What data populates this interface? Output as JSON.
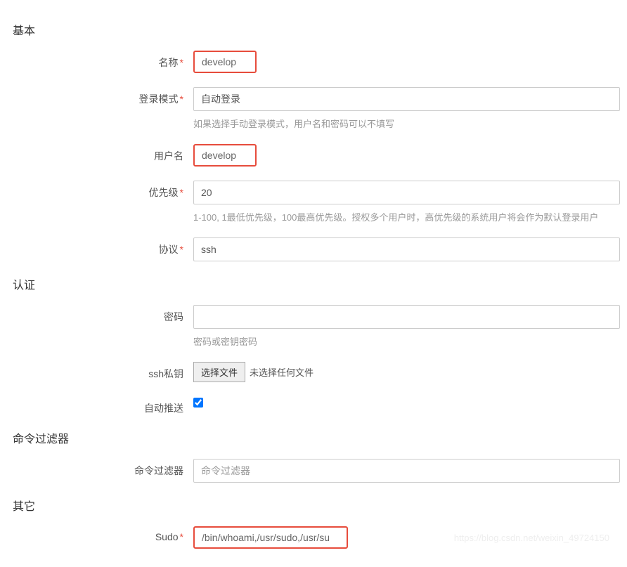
{
  "sections": {
    "basic": "基本",
    "auth": "认证",
    "filter": "命令过滤器",
    "other": "其它"
  },
  "basic": {
    "name": {
      "label": "名称",
      "value": "develop"
    },
    "loginMode": {
      "label": "登录模式",
      "value": "自动登录",
      "help": "如果选择手动登录模式，用户名和密码可以不填写"
    },
    "username": {
      "label": "用户名",
      "value": "develop"
    },
    "priority": {
      "label": "优先级",
      "value": "20",
      "help": "1-100, 1最低优先级，100最高优先级。授权多个用户时，高优先级的系统用户将会作为默认登录用户"
    },
    "protocol": {
      "label": "协议",
      "value": "ssh"
    }
  },
  "auth": {
    "password": {
      "label": "密码",
      "value": "",
      "help": "密码或密钥密码"
    },
    "sshKey": {
      "label": "ssh私钥",
      "button": "选择文件",
      "noFile": "未选择任何文件"
    },
    "autoPush": {
      "label": "自动推送",
      "checked": true
    }
  },
  "filter": {
    "cmdFilter": {
      "label": "命令过滤器",
      "placeholder": "命令过滤器"
    }
  },
  "other": {
    "sudo": {
      "label": "Sudo",
      "value": "/bin/whoami,/usr/sudo,/usr/su"
    }
  },
  "watermark": "https://blog.csdn.net/weixin_49724150"
}
